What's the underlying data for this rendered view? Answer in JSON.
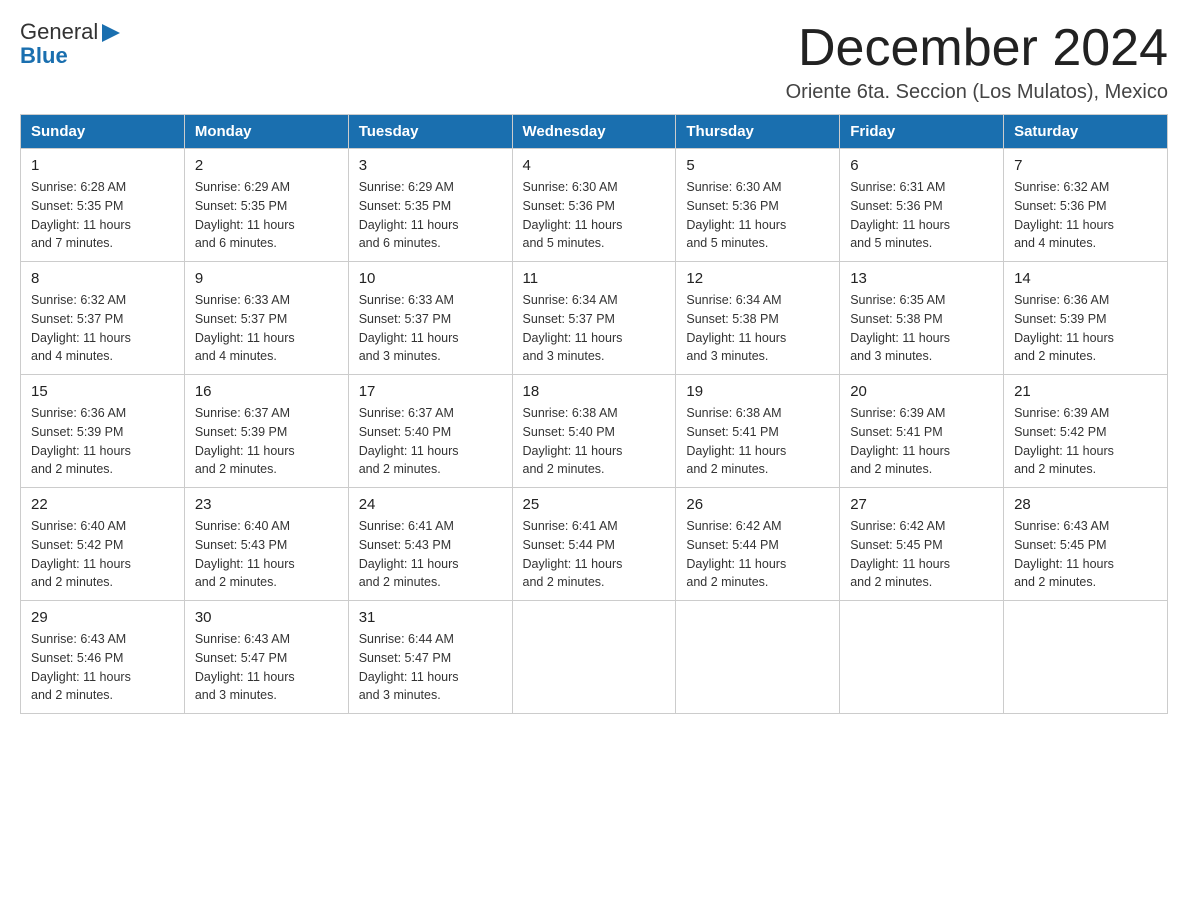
{
  "header": {
    "logo_general": "General",
    "logo_blue": "Blue",
    "month_title": "December 2024",
    "subtitle": "Oriente 6ta. Seccion (Los Mulatos), Mexico"
  },
  "weekdays": [
    "Sunday",
    "Monday",
    "Tuesday",
    "Wednesday",
    "Thursday",
    "Friday",
    "Saturday"
  ],
  "weeks": [
    [
      {
        "day": "1",
        "sunrise": "6:28 AM",
        "sunset": "5:35 PM",
        "daylight": "11 hours and 7 minutes."
      },
      {
        "day": "2",
        "sunrise": "6:29 AM",
        "sunset": "5:35 PM",
        "daylight": "11 hours and 6 minutes."
      },
      {
        "day": "3",
        "sunrise": "6:29 AM",
        "sunset": "5:35 PM",
        "daylight": "11 hours and 6 minutes."
      },
      {
        "day": "4",
        "sunrise": "6:30 AM",
        "sunset": "5:36 PM",
        "daylight": "11 hours and 5 minutes."
      },
      {
        "day": "5",
        "sunrise": "6:30 AM",
        "sunset": "5:36 PM",
        "daylight": "11 hours and 5 minutes."
      },
      {
        "day": "6",
        "sunrise": "6:31 AM",
        "sunset": "5:36 PM",
        "daylight": "11 hours and 5 minutes."
      },
      {
        "day": "7",
        "sunrise": "6:32 AM",
        "sunset": "5:36 PM",
        "daylight": "11 hours and 4 minutes."
      }
    ],
    [
      {
        "day": "8",
        "sunrise": "6:32 AM",
        "sunset": "5:37 PM",
        "daylight": "11 hours and 4 minutes."
      },
      {
        "day": "9",
        "sunrise": "6:33 AM",
        "sunset": "5:37 PM",
        "daylight": "11 hours and 4 minutes."
      },
      {
        "day": "10",
        "sunrise": "6:33 AM",
        "sunset": "5:37 PM",
        "daylight": "11 hours and 3 minutes."
      },
      {
        "day": "11",
        "sunrise": "6:34 AM",
        "sunset": "5:37 PM",
        "daylight": "11 hours and 3 minutes."
      },
      {
        "day": "12",
        "sunrise": "6:34 AM",
        "sunset": "5:38 PM",
        "daylight": "11 hours and 3 minutes."
      },
      {
        "day": "13",
        "sunrise": "6:35 AM",
        "sunset": "5:38 PM",
        "daylight": "11 hours and 3 minutes."
      },
      {
        "day": "14",
        "sunrise": "6:36 AM",
        "sunset": "5:39 PM",
        "daylight": "11 hours and 2 minutes."
      }
    ],
    [
      {
        "day": "15",
        "sunrise": "6:36 AM",
        "sunset": "5:39 PM",
        "daylight": "11 hours and 2 minutes."
      },
      {
        "day": "16",
        "sunrise": "6:37 AM",
        "sunset": "5:39 PM",
        "daylight": "11 hours and 2 minutes."
      },
      {
        "day": "17",
        "sunrise": "6:37 AM",
        "sunset": "5:40 PM",
        "daylight": "11 hours and 2 minutes."
      },
      {
        "day": "18",
        "sunrise": "6:38 AM",
        "sunset": "5:40 PM",
        "daylight": "11 hours and 2 minutes."
      },
      {
        "day": "19",
        "sunrise": "6:38 AM",
        "sunset": "5:41 PM",
        "daylight": "11 hours and 2 minutes."
      },
      {
        "day": "20",
        "sunrise": "6:39 AM",
        "sunset": "5:41 PM",
        "daylight": "11 hours and 2 minutes."
      },
      {
        "day": "21",
        "sunrise": "6:39 AM",
        "sunset": "5:42 PM",
        "daylight": "11 hours and 2 minutes."
      }
    ],
    [
      {
        "day": "22",
        "sunrise": "6:40 AM",
        "sunset": "5:42 PM",
        "daylight": "11 hours and 2 minutes."
      },
      {
        "day": "23",
        "sunrise": "6:40 AM",
        "sunset": "5:43 PM",
        "daylight": "11 hours and 2 minutes."
      },
      {
        "day": "24",
        "sunrise": "6:41 AM",
        "sunset": "5:43 PM",
        "daylight": "11 hours and 2 minutes."
      },
      {
        "day": "25",
        "sunrise": "6:41 AM",
        "sunset": "5:44 PM",
        "daylight": "11 hours and 2 minutes."
      },
      {
        "day": "26",
        "sunrise": "6:42 AM",
        "sunset": "5:44 PM",
        "daylight": "11 hours and 2 minutes."
      },
      {
        "day": "27",
        "sunrise": "6:42 AM",
        "sunset": "5:45 PM",
        "daylight": "11 hours and 2 minutes."
      },
      {
        "day": "28",
        "sunrise": "6:43 AM",
        "sunset": "5:45 PM",
        "daylight": "11 hours and 2 minutes."
      }
    ],
    [
      {
        "day": "29",
        "sunrise": "6:43 AM",
        "sunset": "5:46 PM",
        "daylight": "11 hours and 2 minutes."
      },
      {
        "day": "30",
        "sunrise": "6:43 AM",
        "sunset": "5:47 PM",
        "daylight": "11 hours and 3 minutes."
      },
      {
        "day": "31",
        "sunrise": "6:44 AM",
        "sunset": "5:47 PM",
        "daylight": "11 hours and 3 minutes."
      },
      null,
      null,
      null,
      null
    ]
  ],
  "labels": {
    "sunrise": "Sunrise:",
    "sunset": "Sunset:",
    "daylight": "Daylight:"
  }
}
